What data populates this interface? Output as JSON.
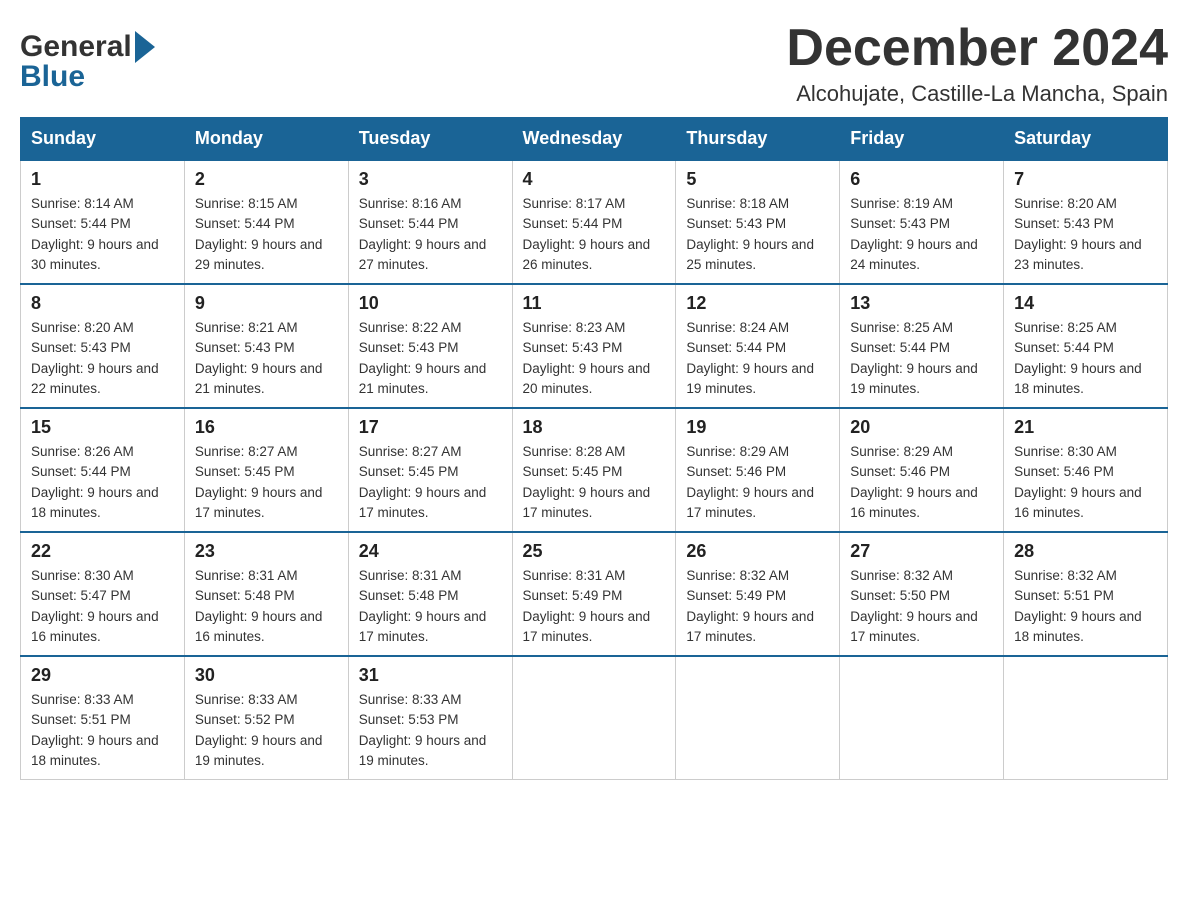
{
  "header": {
    "logo_general": "General",
    "logo_arrow": "▶",
    "logo_blue": "Blue",
    "month_title": "December 2024",
    "location": "Alcohujate, Castille-La Mancha, Spain"
  },
  "days_of_week": [
    "Sunday",
    "Monday",
    "Tuesday",
    "Wednesday",
    "Thursday",
    "Friday",
    "Saturday"
  ],
  "weeks": [
    [
      {
        "day": "1",
        "sunrise": "8:14 AM",
        "sunset": "5:44 PM",
        "daylight": "9 hours and 30 minutes."
      },
      {
        "day": "2",
        "sunrise": "8:15 AM",
        "sunset": "5:44 PM",
        "daylight": "9 hours and 29 minutes."
      },
      {
        "day": "3",
        "sunrise": "8:16 AM",
        "sunset": "5:44 PM",
        "daylight": "9 hours and 27 minutes."
      },
      {
        "day": "4",
        "sunrise": "8:17 AM",
        "sunset": "5:44 PM",
        "daylight": "9 hours and 26 minutes."
      },
      {
        "day": "5",
        "sunrise": "8:18 AM",
        "sunset": "5:43 PM",
        "daylight": "9 hours and 25 minutes."
      },
      {
        "day": "6",
        "sunrise": "8:19 AM",
        "sunset": "5:43 PM",
        "daylight": "9 hours and 24 minutes."
      },
      {
        "day": "7",
        "sunrise": "8:20 AM",
        "sunset": "5:43 PM",
        "daylight": "9 hours and 23 minutes."
      }
    ],
    [
      {
        "day": "8",
        "sunrise": "8:20 AM",
        "sunset": "5:43 PM",
        "daylight": "9 hours and 22 minutes."
      },
      {
        "day": "9",
        "sunrise": "8:21 AM",
        "sunset": "5:43 PM",
        "daylight": "9 hours and 21 minutes."
      },
      {
        "day": "10",
        "sunrise": "8:22 AM",
        "sunset": "5:43 PM",
        "daylight": "9 hours and 21 minutes."
      },
      {
        "day": "11",
        "sunrise": "8:23 AM",
        "sunset": "5:43 PM",
        "daylight": "9 hours and 20 minutes."
      },
      {
        "day": "12",
        "sunrise": "8:24 AM",
        "sunset": "5:44 PM",
        "daylight": "9 hours and 19 minutes."
      },
      {
        "day": "13",
        "sunrise": "8:25 AM",
        "sunset": "5:44 PM",
        "daylight": "9 hours and 19 minutes."
      },
      {
        "day": "14",
        "sunrise": "8:25 AM",
        "sunset": "5:44 PM",
        "daylight": "9 hours and 18 minutes."
      }
    ],
    [
      {
        "day": "15",
        "sunrise": "8:26 AM",
        "sunset": "5:44 PM",
        "daylight": "9 hours and 18 minutes."
      },
      {
        "day": "16",
        "sunrise": "8:27 AM",
        "sunset": "5:45 PM",
        "daylight": "9 hours and 17 minutes."
      },
      {
        "day": "17",
        "sunrise": "8:27 AM",
        "sunset": "5:45 PM",
        "daylight": "9 hours and 17 minutes."
      },
      {
        "day": "18",
        "sunrise": "8:28 AM",
        "sunset": "5:45 PM",
        "daylight": "9 hours and 17 minutes."
      },
      {
        "day": "19",
        "sunrise": "8:29 AM",
        "sunset": "5:46 PM",
        "daylight": "9 hours and 17 minutes."
      },
      {
        "day": "20",
        "sunrise": "8:29 AM",
        "sunset": "5:46 PM",
        "daylight": "9 hours and 16 minutes."
      },
      {
        "day": "21",
        "sunrise": "8:30 AM",
        "sunset": "5:46 PM",
        "daylight": "9 hours and 16 minutes."
      }
    ],
    [
      {
        "day": "22",
        "sunrise": "8:30 AM",
        "sunset": "5:47 PM",
        "daylight": "9 hours and 16 minutes."
      },
      {
        "day": "23",
        "sunrise": "8:31 AM",
        "sunset": "5:48 PM",
        "daylight": "9 hours and 16 minutes."
      },
      {
        "day": "24",
        "sunrise": "8:31 AM",
        "sunset": "5:48 PM",
        "daylight": "9 hours and 17 minutes."
      },
      {
        "day": "25",
        "sunrise": "8:31 AM",
        "sunset": "5:49 PM",
        "daylight": "9 hours and 17 minutes."
      },
      {
        "day": "26",
        "sunrise": "8:32 AM",
        "sunset": "5:49 PM",
        "daylight": "9 hours and 17 minutes."
      },
      {
        "day": "27",
        "sunrise": "8:32 AM",
        "sunset": "5:50 PM",
        "daylight": "9 hours and 17 minutes."
      },
      {
        "day": "28",
        "sunrise": "8:32 AM",
        "sunset": "5:51 PM",
        "daylight": "9 hours and 18 minutes."
      }
    ],
    [
      {
        "day": "29",
        "sunrise": "8:33 AM",
        "sunset": "5:51 PM",
        "daylight": "9 hours and 18 minutes."
      },
      {
        "day": "30",
        "sunrise": "8:33 AM",
        "sunset": "5:52 PM",
        "daylight": "9 hours and 19 minutes."
      },
      {
        "day": "31",
        "sunrise": "8:33 AM",
        "sunset": "5:53 PM",
        "daylight": "9 hours and 19 minutes."
      },
      null,
      null,
      null,
      null
    ]
  ]
}
